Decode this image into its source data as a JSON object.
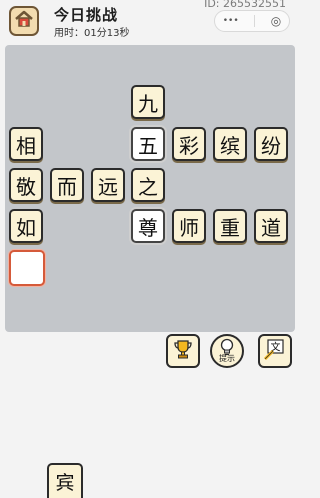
{
  "header": {
    "title": "今日挑战",
    "timer": "用时：01分13秒",
    "user_id": "ID: 265532551",
    "capsule_more": "•••",
    "capsule_close": "◎"
  },
  "board": {
    "tiles": {
      "r0c3": "九",
      "r1c0": "相",
      "r1c3": "五",
      "r1c4": "彩",
      "r1c5": "缤",
      "r1c6": "纷",
      "r2c0": "敬",
      "r2c1": "而",
      "r2c2": "远",
      "r2c3": "之",
      "r3c0": "如",
      "r3c3": "尊",
      "r3c4": "师",
      "r3c5": "重",
      "r3c6": "道",
      "r4c0": ""
    }
  },
  "tools": {
    "hint_label": "提示"
  },
  "candidates": [
    "宾"
  ],
  "icons": {
    "home": "home-icon",
    "trophy": "trophy-icon",
    "hint": "lightbulb-icon",
    "text": "text-edit-icon"
  },
  "colors": {
    "tile_bg": "#fbf3d6",
    "board_bg": "#c3c6ca",
    "active_border": "#d55a3a"
  }
}
